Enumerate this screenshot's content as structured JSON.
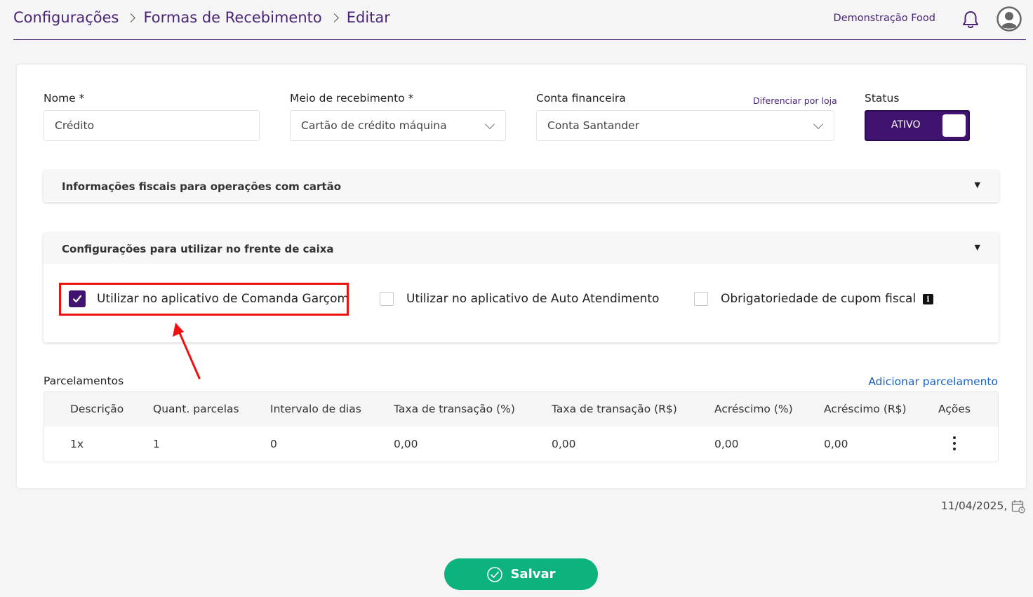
{
  "header": {
    "breadcrumb": [
      "Configurações",
      "Formas de Recebimento",
      "Editar"
    ],
    "company": "Demonstração Food"
  },
  "form": {
    "nome": {
      "label": "Nome *",
      "value": "Crédito"
    },
    "meio": {
      "label": "Meio de recebimento *",
      "value": "Cartão de crédito máquina"
    },
    "conta": {
      "label": "Conta financeira",
      "value": "Conta Santander",
      "link": "Diferenciar por loja"
    },
    "status": {
      "label": "Status",
      "value": "ATIVO"
    }
  },
  "panels": {
    "fiscal": {
      "title": "Informações fiscais para operações com cartão"
    },
    "caixa": {
      "title": "Configurações para utilizar no frente de caixa",
      "options": [
        {
          "label": "Utilizar no aplicativo de Comanda Garçom",
          "checked": true
        },
        {
          "label": "Utilizar no aplicativo de Auto Atendimento",
          "checked": false
        },
        {
          "label": "Obrigatoriedade de cupom fiscal",
          "checked": false
        }
      ]
    }
  },
  "parcelamentos": {
    "title": "Parcelamentos",
    "add_link": "Adicionar parcelamento",
    "columns": [
      "Descrição",
      "Quant. parcelas",
      "Intervalo de dias",
      "Taxa de transação (%)",
      "Taxa de transação (R$)",
      "Acréscimo (%)",
      "Acréscimo (R$)",
      "Ações"
    ],
    "rows": [
      [
        "1x",
        "1",
        "0",
        "0,00",
        "0,00",
        "0,00",
        "0,00"
      ]
    ]
  },
  "footer": {
    "date": "11/04/2025,",
    "save_label": "Salvar"
  },
  "colors": {
    "brand": "#4a2575",
    "toggle": "#3f136e",
    "save": "#0db37e",
    "highlight": "#ee1111",
    "link": "#1a5fbf"
  }
}
